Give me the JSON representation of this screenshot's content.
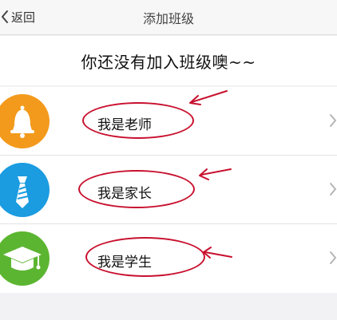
{
  "nav": {
    "back_label": "返回",
    "title": "添加班级"
  },
  "banner": {
    "text": "你还没有加入班级噢~~"
  },
  "options": [
    {
      "label": "我是老师",
      "icon": "bell-icon",
      "color": "#f39a1c"
    },
    {
      "label": "我是家长",
      "icon": "tie-icon",
      "color": "#1b9be0"
    },
    {
      "label": "我是学生",
      "icon": "graduation-cap-icon",
      "color": "#5cb531"
    }
  ],
  "annotation_color": "#c8102e"
}
